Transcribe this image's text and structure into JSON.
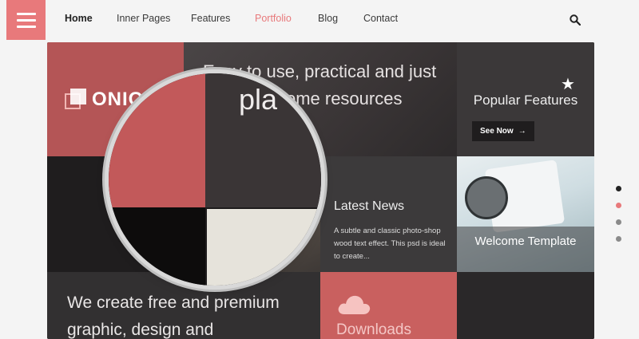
{
  "header": {
    "menu_icon": "hamburger-icon",
    "nav": [
      {
        "label": "Home",
        "state": "active"
      },
      {
        "label": "Inner Pages",
        "state": "normal"
      },
      {
        "label": "Features",
        "state": "normal"
      },
      {
        "label": "Portfolio",
        "state": "highlight"
      },
      {
        "label": "Blog",
        "state": "normal"
      },
      {
        "label": "Contact",
        "state": "normal"
      }
    ],
    "search_icon": "search-icon"
  },
  "tiles": {
    "logo": {
      "text": "ONION"
    },
    "hero": {
      "text": "Easy to use, practical and just plain awesome resources"
    },
    "popular": {
      "title": "Popular Features",
      "button": "See Now",
      "icon": "star-icon"
    },
    "news": {
      "title": "Latest News",
      "text": "A subtle and classic photo-shop wood text effect. This psd is ideal to create..."
    },
    "welcome": {
      "title": "Welcome Template"
    },
    "create": {
      "text": "We create free and premium graphic, design and"
    },
    "downloads": {
      "title": "Downloads",
      "icon": "cloud-icon"
    }
  },
  "magnifier": {
    "text": "pla"
  },
  "pager": {
    "count": 4,
    "active_index": 1
  },
  "colors": {
    "accent": "#e8797b",
    "dark": "#2c2a2b",
    "logo_bg": "#b45556"
  }
}
